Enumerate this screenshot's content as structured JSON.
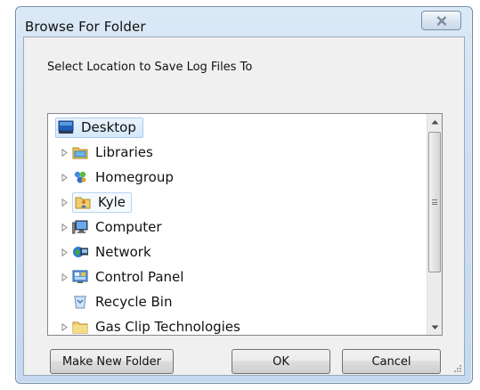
{
  "window": {
    "title": "Browse For Folder",
    "close_glyph": "✕"
  },
  "prompt": "Select Location to Save Log Files To",
  "tree": {
    "items": [
      {
        "label": "Desktop",
        "icon": "desktop-icon",
        "expandable": false,
        "state": "selected"
      },
      {
        "label": "Libraries",
        "icon": "libraries-icon",
        "expandable": true,
        "state": ""
      },
      {
        "label": "Homegroup",
        "icon": "homegroup-icon",
        "expandable": true,
        "state": ""
      },
      {
        "label": "Kyle",
        "icon": "user-folder-icon",
        "expandable": true,
        "state": "hovered"
      },
      {
        "label": "Computer",
        "icon": "computer-icon",
        "expandable": true,
        "state": ""
      },
      {
        "label": "Network",
        "icon": "network-icon",
        "expandable": true,
        "state": ""
      },
      {
        "label": "Control Panel",
        "icon": "control-panel-icon",
        "expandable": true,
        "state": ""
      },
      {
        "label": "Recycle Bin",
        "icon": "recycle-bin-icon",
        "expandable": false,
        "state": ""
      },
      {
        "label": "Gas Clip Technologies",
        "icon": "folder-icon",
        "expandable": true,
        "state": ""
      }
    ]
  },
  "buttons": {
    "make_new_folder": "Make New Folder",
    "ok": "OK",
    "cancel": "Cancel"
  }
}
